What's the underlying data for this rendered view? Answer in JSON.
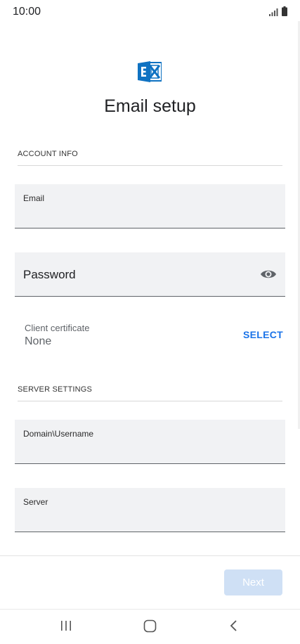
{
  "status_bar": {
    "time": "10:00"
  },
  "app": {
    "title": "Email setup"
  },
  "account_info": {
    "header": "ACCOUNT INFO",
    "email_label": "Email",
    "password_label": "Password",
    "client_certificate_label": "Client certificate",
    "client_certificate_value": "None",
    "select_label": "SELECT"
  },
  "server_settings": {
    "header": "SERVER SETTINGS",
    "domain_username_label": "Domain\\Username",
    "server_label": "Server"
  },
  "footer": {
    "next_label": "Next"
  },
  "colors": {
    "accent": "#1a73e8",
    "field_bg": "#f1f2f4",
    "exchange_blue": "#0f72c2"
  }
}
